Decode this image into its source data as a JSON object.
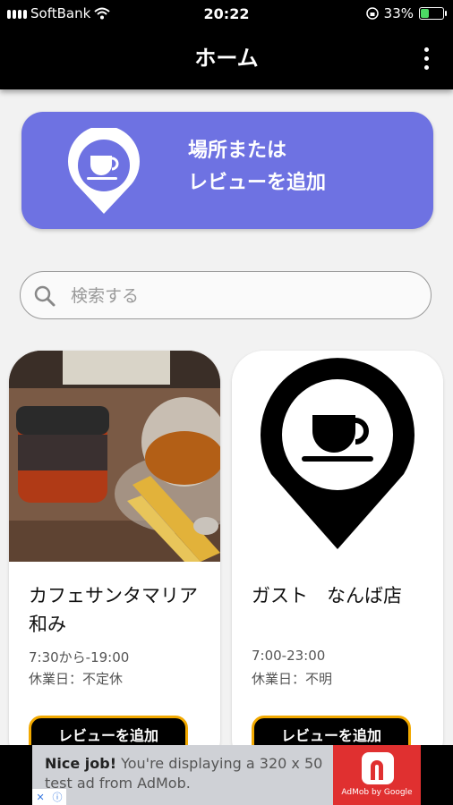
{
  "status_bar": {
    "carrier": "SoftBank",
    "time": "20:22",
    "battery": "33%",
    "battery_level": 0.33
  },
  "app_bar": {
    "title": "ホーム",
    "menu_icon": "more-vertical-icon"
  },
  "add_card": {
    "line1": "場所または",
    "line2": "レビューを追加",
    "icon": "coffee-pin-icon"
  },
  "search": {
    "placeholder": "検索する",
    "value": ""
  },
  "shops": [
    {
      "name": "カフェサンタマリア和み",
      "hours": "7:30から-19:00",
      "holiday": "休業日：不定休",
      "button_label": "レビューを追加",
      "image": "tea-photo"
    },
    {
      "name": "ガスト　なんば店",
      "hours": "7:00-23:00",
      "holiday": "休業日：不明",
      "button_label": "レビューを追加",
      "image": "coffee-pin-icon"
    }
  ],
  "ad": {
    "headline": "Nice job!",
    "body": " You're displaying a 320 x 50 test ad from AdMob.",
    "brand": "AdMob by Google"
  },
  "colors": {
    "accent": "#6e72e2",
    "button_border": "#f2a900",
    "bar": "#000000"
  }
}
